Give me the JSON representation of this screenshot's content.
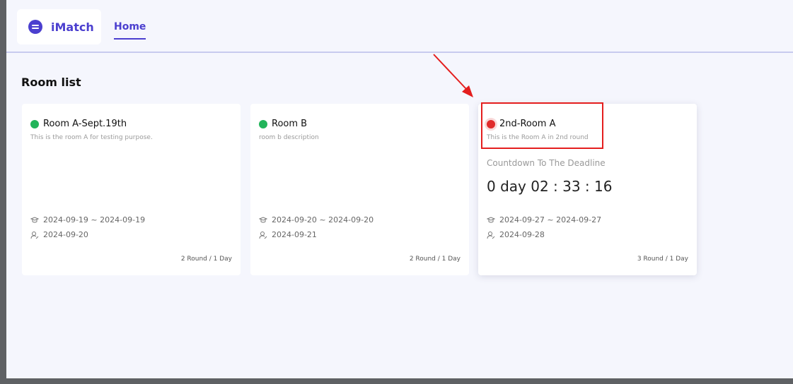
{
  "app": {
    "name": "iMatch"
  },
  "nav": {
    "home_label": "Home"
  },
  "page": {
    "title": "Room list"
  },
  "rooms": [
    {
      "title": "Room A-Sept.19th",
      "description": "This is the room A for testing purpose.",
      "status_color": "#22b45a",
      "date_range": "2024-09-19 ~ 2024-09-19",
      "date_second": "2024-09-20",
      "rounds": "2 Round / 1 Day"
    },
    {
      "title": "Room B",
      "description": "room b description",
      "status_color": "#22b45a",
      "date_range": "2024-09-20 ~ 2024-09-20",
      "date_second": "2024-09-21",
      "rounds": "2 Round / 1 Day"
    },
    {
      "title": "2nd-Room A",
      "description": "This is the Room A in 2nd round",
      "status_color": "#e02b2b",
      "countdown_label": "Countdown To The Deadline",
      "countdown_value": "0 day 02 : 33 : 16",
      "date_range": "2024-09-27 ~ 2024-09-27",
      "date_second": "2024-09-28",
      "rounds": "3 Round / 1 Day"
    }
  ],
  "icons": {
    "logo": "imatch-logo-icon",
    "date_range": "graduation-cap-icon",
    "date_second": "user-edit-icon"
  },
  "colors": {
    "brand": "#4b3fcf",
    "status_active": "#22b45a",
    "status_alert": "#e02b2b",
    "annotation": "#e41e1e"
  }
}
